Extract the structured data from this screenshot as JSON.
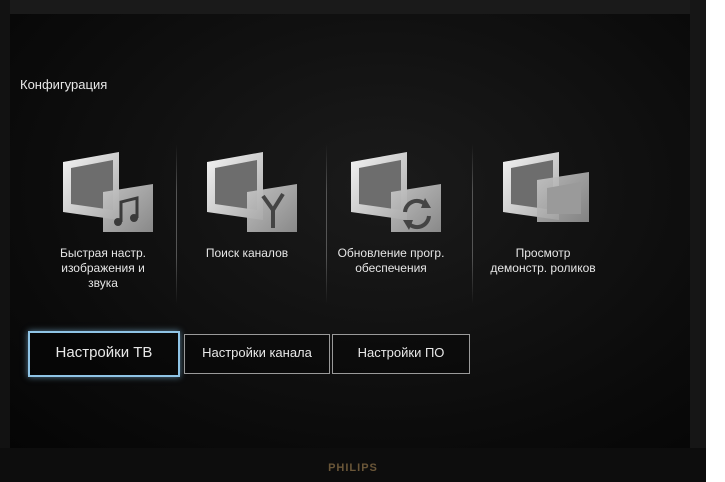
{
  "menu": {
    "title": "Конфигурация"
  },
  "options": [
    {
      "label": "Быстрая настр.\nизображения и\nзвука",
      "icon": "music-note-icon"
    },
    {
      "label": "Поиск каналов",
      "icon": "antenna-icon"
    },
    {
      "label": "Обновление прогр.\nобеспечения",
      "icon": "refresh-icon"
    },
    {
      "label": "Просмотр\nдемонстр. роликов",
      "icon": "demo-windows-icon"
    }
  ],
  "tabs": [
    {
      "label": "Настройки ТВ",
      "active": true
    },
    {
      "label": "Настройки канала",
      "active": false
    },
    {
      "label": "Настройки ПО",
      "active": false
    }
  ],
  "brand": "PHILIPS"
}
